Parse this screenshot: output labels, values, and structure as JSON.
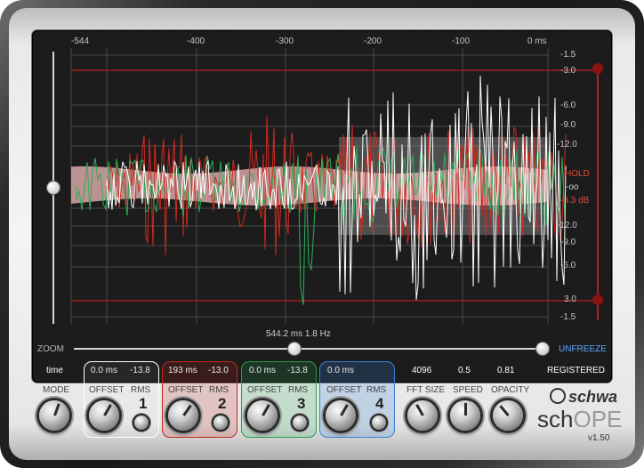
{
  "time_ticks": [
    "-544",
    "-400",
    "-300",
    "-200",
    "-100",
    "0 ms"
  ],
  "db_ticks_right": [
    "-1.5",
    "-3.0",
    "-6.0",
    "-9.0",
    "-12.0",
    "-12.0",
    "-9.0",
    "-6.0",
    "3.0",
    "-1.5"
  ],
  "hold": {
    "label": "HOLD",
    "value": "-oo",
    "db": "-3.3 dB"
  },
  "readout": "544.2 ms 1.8 Hz",
  "zoom_label": "ZOOM",
  "zoom_level": 0.47,
  "unfreeze_label": "UNFREEZE",
  "left_slider_level": 0.5,
  "status_row": {
    "time": "time",
    "fft": "4096",
    "speed": "0.5",
    "opacity": "0.81",
    "registered": "REGISTERED"
  },
  "mode_label": "MODE",
  "channels": [
    {
      "number": "1",
      "offset_value": "0.0 ms",
      "rms_value": "-13.8",
      "offset_label": "OFFSET",
      "rms_label": "RMS",
      "color": "#ffffff"
    },
    {
      "number": "2",
      "offset_value": "193 ms",
      "rms_value": "-13.0",
      "offset_label": "OFFSET",
      "rms_label": "RMS",
      "color": "#d23a2a"
    },
    {
      "number": "3",
      "offset_value": "0.0 ms",
      "rms_value": "-13.8",
      "offset_label": "OFFSET",
      "rms_label": "RMS",
      "color": "#2bb05a"
    },
    {
      "number": "4",
      "offset_value": "0.0 ms",
      "rms_value": "",
      "offset_label": "OFFSET",
      "rms_label": "RMS",
      "color": "#3a7fd8"
    }
  ],
  "fft_label": "FFT SIZE",
  "speed_label": "SPEED",
  "opacity_label": "OPACITY",
  "brand": {
    "logo": "schwa",
    "product_a": "sch",
    "product_b": "OPE",
    "version": "v1.50"
  }
}
